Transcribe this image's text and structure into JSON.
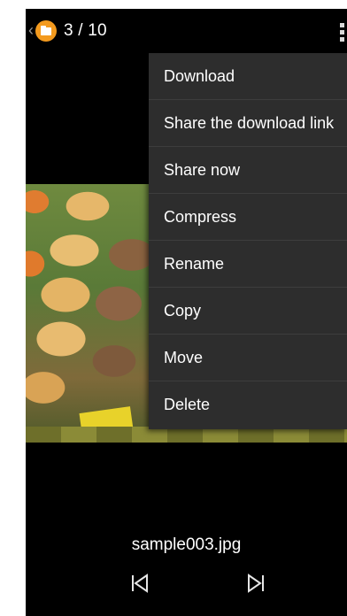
{
  "header": {
    "back_icon": "chevron-left-icon",
    "app_icon": "folder-bubble-icon",
    "counter": "3 / 10",
    "overflow_icon": "overflow-menu-icon"
  },
  "menu": {
    "items": [
      {
        "label": "Download"
      },
      {
        "label": "Share the download link"
      },
      {
        "label": "Share now"
      },
      {
        "label": "Compress"
      },
      {
        "label": "Rename"
      },
      {
        "label": "Copy"
      },
      {
        "label": "Move"
      },
      {
        "label": "Delete"
      }
    ]
  },
  "viewer": {
    "filename": "sample003.jpg",
    "prev_icon": "skip-previous-icon",
    "next_icon": "skip-next-icon"
  },
  "colors": {
    "background": "#000000",
    "menu_background": "#2d2d2d",
    "accent": "#f39a1e"
  }
}
